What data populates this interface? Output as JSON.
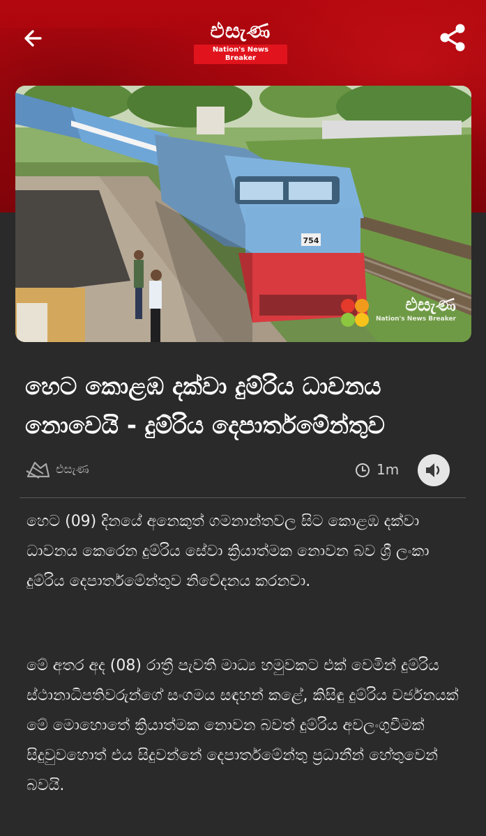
{
  "app": {
    "logo_text": "එසැණ",
    "logo_tagline": "Nation's News Breaker"
  },
  "header": {
    "back_icon": "arrow-left-icon",
    "share_icon": "share-icon"
  },
  "article": {
    "image_watermark_text": "එසැණ",
    "image_watermark_tagline": "Nation's News Breaker",
    "locomotive_number": "754",
    "title": "හෙට කොළඹ දක්වා දුම්රිය ධාවනය නොවෙයි - දුම්රිය දෙපාර්තමේන්තුව",
    "author": "එසැණ",
    "read_time": "1m",
    "paragraphs": [
      "හෙට (09) දිනයේ අනෙකුත් ගමනාන්තවල සිට කොළඹ දක්වා ධාවනය කෙරෙන දුම්රිය සේවා ක්‍රියාත්මක නොවන බව ශ්‍රී ලංකා දුම්රිය දෙපාර්තමේන්තුව නිවේදනය කරනවා.",
      "මේ අතර අද (08) රාත්‍රී පැවති මාධ්‍ය හමුවකට එක් වෙමින් දුම්රිය ස්ථානාධිපතිවරුන්ගේ සංගමය සඳහන් කළේ, කිසිඳු දුම්රිය වර්ජනයක් මේ මොහොතේ ක්‍රියාත්මක නොවන බවත් දුම්රිය අවලංගුවීමක් සිදුවුවහොත් එය සිදුවන්නේ දෙපාර්තමේන්තු ප්‍රධානීන් හේතුවෙන් බවයි."
    ]
  },
  "colors": {
    "brand_red": "#b3070f",
    "background": "#2a2a2a"
  }
}
